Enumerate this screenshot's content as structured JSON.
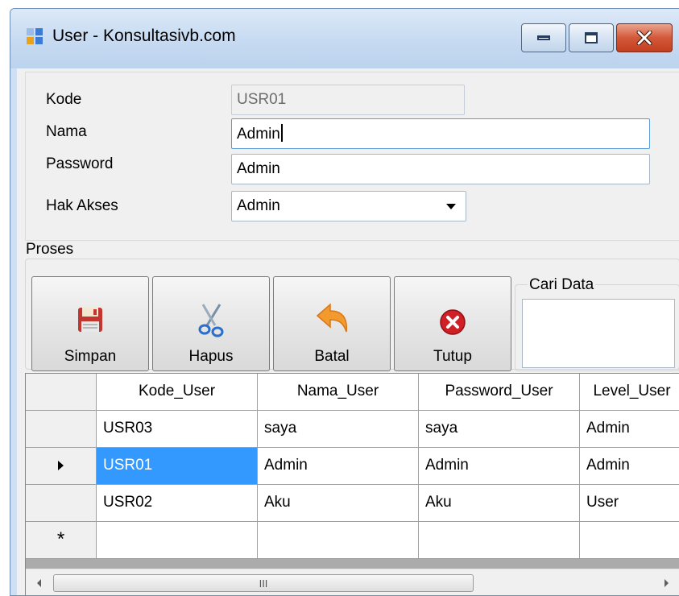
{
  "window": {
    "title": "User - Konsultasivb.com",
    "controls": {
      "minimize_icon": "minimize-icon",
      "maximize_icon": "maximize-icon",
      "close_icon": "close-icon"
    }
  },
  "form": {
    "kode": {
      "label": "Kode",
      "value": "USR01"
    },
    "nama": {
      "label": "Nama",
      "value": "Admin"
    },
    "password": {
      "label": "Password",
      "value": "Admin"
    },
    "hak_akses": {
      "label": "Hak Akses",
      "value": "Admin"
    }
  },
  "proses": {
    "title": "Proses",
    "buttons": [
      {
        "label": "Simpan",
        "icon": "floppy-disk-icon"
      },
      {
        "label": "Hapus",
        "icon": "scissors-icon"
      },
      {
        "label": "Batal",
        "icon": "undo-arrow-icon"
      },
      {
        "label": "Tutup",
        "icon": "close-circle-icon"
      }
    ]
  },
  "cari_data": {
    "title": "Cari Data",
    "value": ""
  },
  "grid": {
    "columns": [
      "Kode_User",
      "Nama_User",
      "Password_User",
      "Level_User"
    ],
    "rows": [
      [
        "USR03",
        "saya",
        "saya",
        "Admin"
      ],
      [
        "USR01",
        "Admin",
        "Admin",
        "Admin"
      ],
      [
        "USR02",
        "Aku",
        "Aku",
        "User"
      ]
    ],
    "new_row_marker": "*",
    "scroll_marker": "III"
  },
  "colors": {
    "selection": "#3399ff",
    "close_button": "#c84a2b"
  }
}
